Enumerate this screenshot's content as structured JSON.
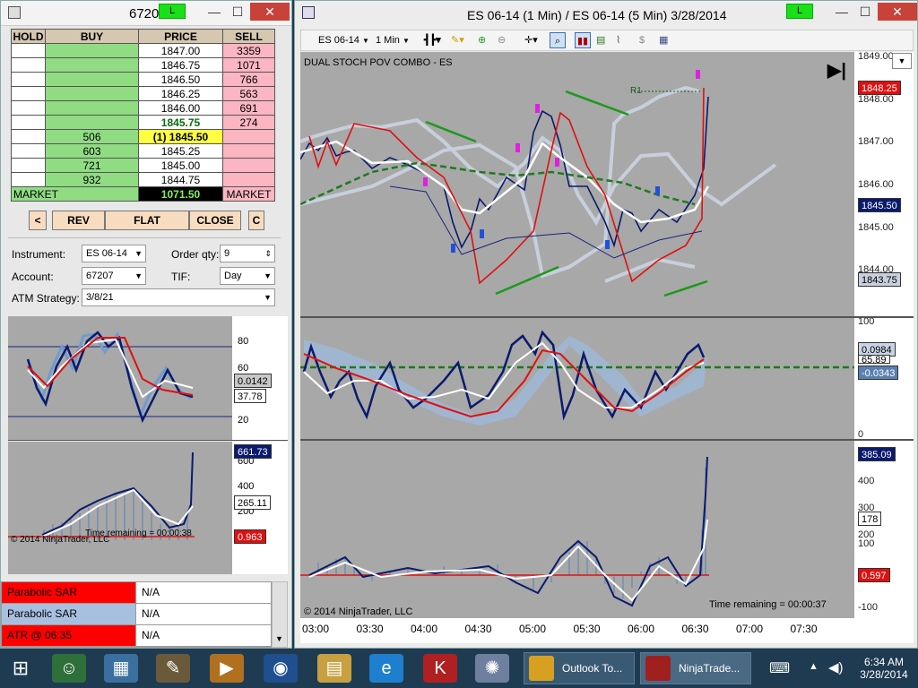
{
  "left": {
    "title": "6720",
    "status_light": "L",
    "headers": [
      "HOLD",
      "BUY",
      "PRICE",
      "SELL"
    ],
    "rows": [
      {
        "buy": "",
        "price": "1847.00",
        "sell": "3359"
      },
      {
        "buy": "",
        "price": "1846.75",
        "sell": "1071"
      },
      {
        "buy": "",
        "price": "1846.50",
        "sell": "766"
      },
      {
        "buy": "",
        "price": "1846.25",
        "sell": "563"
      },
      {
        "buy": "",
        "price": "1846.00",
        "sell": "691"
      },
      {
        "buy": "",
        "price": "1845.75",
        "sell": "274"
      },
      {
        "buy": "506",
        "price": "(1) 1845.50",
        "sell": ""
      },
      {
        "buy": "603",
        "price": "1845.25",
        "sell": ""
      },
      {
        "buy": "721",
        "price": "1845.00",
        "sell": ""
      },
      {
        "buy": "932",
        "price": "1844.75",
        "sell": ""
      }
    ],
    "market_left": "MARKET",
    "market_price": "1071.50",
    "market_right": "MARKET",
    "btn_lt": "<",
    "btn_rev": "REV",
    "btn_flat": "FLAT",
    "btn_close": "CLOSE",
    "btn_c": "C",
    "instrument_label": "Instrument:",
    "instrument": "ES 06-14",
    "orderqty_label": "Order qty:",
    "orderqty": "9",
    "account_label": "Account:",
    "account": "67207",
    "tif_label": "TIF:",
    "tif": "Day",
    "atm_label": "ATM Strategy:",
    "atm": "3/8/21",
    "p1_ticks": [
      "80",
      "60",
      "20"
    ],
    "p1_tag1": "0.0142",
    "p1_tag2": "37.78",
    "p2_ticks": [
      "600",
      "400",
      "200"
    ],
    "p2_tag1": "661.73",
    "p2_tag2": "265.11",
    "p2_tag3": "0.963",
    "copyright": "© 2014 NinjaTrader, LLC",
    "time_remaining": "Time remaining = 00:00:38",
    "list": [
      {
        "name": "Parabolic SAR",
        "value": "N/A"
      },
      {
        "name": "Parabolic SAR",
        "value": "N/A"
      },
      {
        "name": "ATR @ 06:35",
        "value": "N/A"
      }
    ]
  },
  "right": {
    "title": "ES 06-14 (1 Min) / ES 06-14 (5 Min)  3/28/2014",
    "status_light": "L",
    "instrument": "ES 06-14",
    "interval": "1 Min",
    "chart_label": "DUAL STOCH POV COMBO - ES",
    "r1": "R1",
    "price_ticks": [
      "1849.00",
      "1848.00",
      "1847.00",
      "1846.00",
      "1845.00",
      "1844.00"
    ],
    "last_price": "1848.25",
    "bid_price": "1845.50",
    "low_price": "1843.75",
    "p2_ticks": [
      "100",
      "0"
    ],
    "p2_tag1": "0.0984",
    "p2_tag2": "65.89",
    "p2_tag3": "-0.0343",
    "p3_ticks": [
      "400",
      "300",
      "200",
      "100",
      "-100"
    ],
    "p3_tag1": "385.09",
    "p3_tag2": "178",
    "p3_tag3": "0.597",
    "copyright": "© 2014 NinjaTrader, LLC",
    "time_remaining": "Time remaining = 00:00:37",
    "xticks": [
      "03:00",
      "03:30",
      "04:00",
      "04:30",
      "05:00",
      "05:30",
      "06:00",
      "06:30",
      "07:00",
      "07:30"
    ]
  },
  "taskbar": {
    "app1": "Outlook To...",
    "app2": "NinjaTrade...",
    "time": "6:34 AM",
    "date": "3/28/2014"
  },
  "colors": {
    "buy": "#8fdc82",
    "sell": "#fbb6c1",
    "panel": "#a8a8a8",
    "accent_green": "#19e019"
  }
}
